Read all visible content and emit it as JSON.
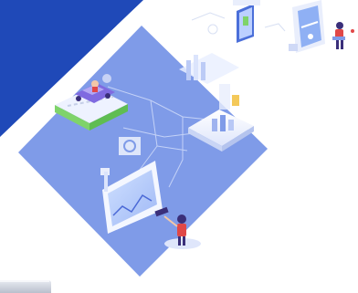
{
  "colors": {
    "page_background": "#ffffff",
    "banner_blue": "#1f49b8",
    "diamond_periwinkle": "#7f9be8",
    "panel_white": "#f4f7ff",
    "accent_violet": "#7f6ae0",
    "accent_green": "#7fd36a",
    "accent_red": "#e04848"
  },
  "illustration": {
    "icons": [
      "isometric-car-on-platform-icon",
      "bar-chart-dashboard-icon",
      "3d-bar-chart-card-icon",
      "phone-screen-icon",
      "tablet-screen-icon",
      "person-with-laptop-icon",
      "presenter-figure-icon",
      "analytics-monitor-icon"
    ]
  },
  "control_stub": {
    "icon": "tab-button-icon"
  }
}
